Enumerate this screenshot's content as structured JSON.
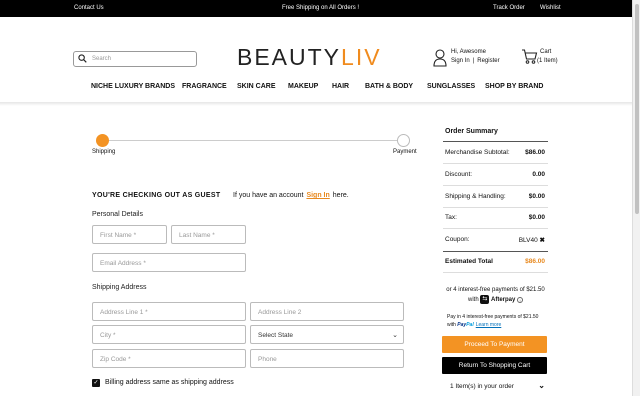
{
  "topbar": {
    "contact": "Contact Us",
    "promo": "Free Shipping on All Orders !",
    "track": "Track Order",
    "wishlist": "Wishlist"
  },
  "header": {
    "search_placeholder": "Search",
    "logo_main": "BEAUTY",
    "logo_accent": "LIV",
    "greeting": "Hi, Awesome",
    "sign_in": "Sign In",
    "sep": "|",
    "register": "Register",
    "cart_label": "Cart",
    "cart_count": "(1 Item)"
  },
  "nav": [
    "NICHE LUXURY BRANDS",
    "FRAGRANCE",
    "SKIN CARE",
    "MAKEUP",
    "HAIR",
    "BATH & BODY",
    "SUNGLASSES",
    "SHOP BY BRAND"
  ],
  "progress": {
    "step1": "Shipping",
    "step2": "Payment",
    "current_step": 1,
    "accent_color": "#f39323"
  },
  "form": {
    "guest_heading": "YOU'RE CHECKING OUT AS GUEST",
    "account_prompt": "If you have an account",
    "sign_in_link": "Sign In",
    "account_suffix": "here.",
    "personal_heading": "Personal Details",
    "shipping_heading": "Shipping Address",
    "fields": {
      "first_name": "First Name *",
      "last_name": "Last Name *",
      "email": "Email Address *",
      "address1": "Address Line 1 *",
      "address2": "Address Line 2",
      "city": "City *",
      "state": "Select State",
      "zip": "Zip Code *",
      "phone": "Phone"
    },
    "billing_same": "Billing address same as shipping address",
    "billing_same_checked": true
  },
  "summary": {
    "title": "Order Summary",
    "rows": [
      {
        "label": "Merchandise Subtotal:",
        "value": "$86.00"
      },
      {
        "label": "Discount:",
        "value": "0.00"
      },
      {
        "label": "Shipping & Handling:",
        "value": "$0.00"
      },
      {
        "label": "Tax:",
        "value": "$0.00"
      },
      {
        "label": "Coupon:",
        "value": "BLV40"
      }
    ],
    "total_label": "Estimated Total",
    "total_value": "$86.00",
    "afterpay_text": "or 4 interest-free payments of $21.50",
    "afterpay_with": "with",
    "afterpay_brand": "Afterpay",
    "paypal_text": "Pay in 4 interest-free payments of $21.50",
    "paypal_with": "with",
    "paypal_logo_a": "Pay",
    "paypal_logo_b": "Pal",
    "learn_more": "Learn more",
    "proceed_btn": "Proceed To Payment",
    "return_btn": "Return To Shopping Cart",
    "items_label": "1 Item(s) in your order"
  },
  "colors": {
    "brand_orange": "#f39323",
    "topbar_bg": "#000000",
    "button_dark": "#000000"
  }
}
